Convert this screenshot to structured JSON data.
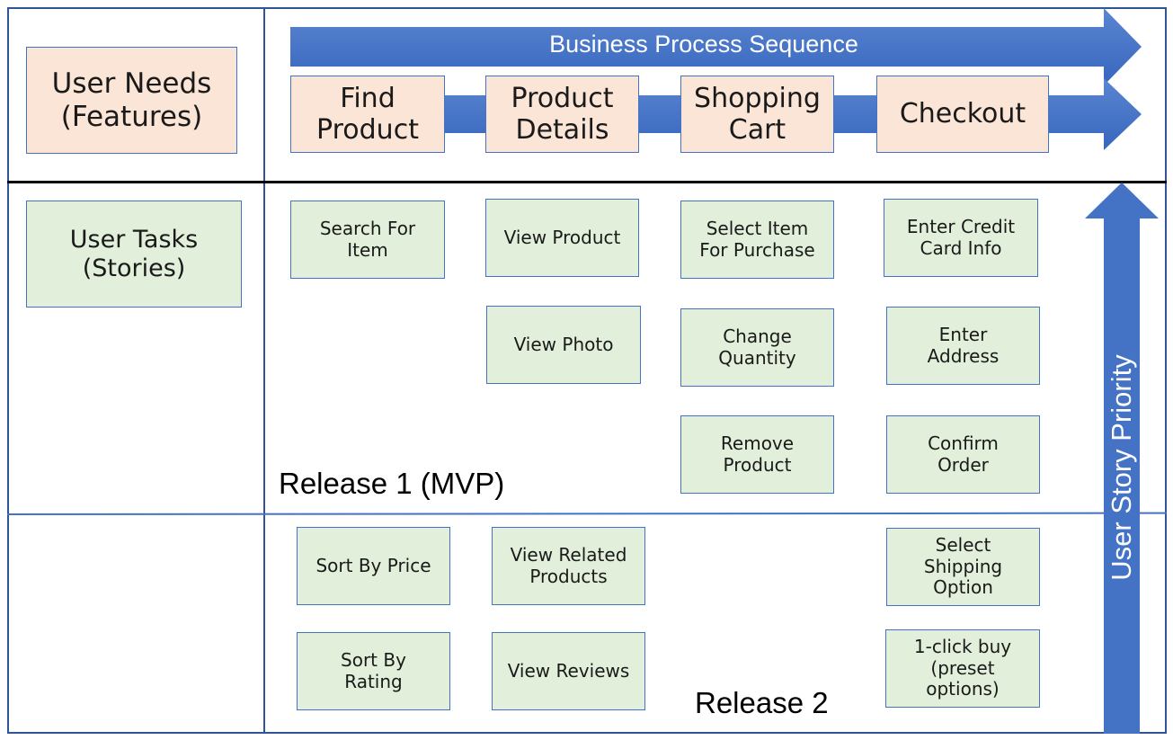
{
  "row_headers": {
    "user_needs": "User Needs\n(Features)",
    "user_tasks": "User Tasks\n(Stories)"
  },
  "business_process": {
    "label": "Business Process Sequence",
    "color": "#4472c4"
  },
  "priority_arrow": {
    "label": "User Story Priority",
    "color": "#4472c4"
  },
  "features": [
    {
      "label": "Find\nProduct"
    },
    {
      "label": "Product\nDetails"
    },
    {
      "label": "Shopping\nCart"
    },
    {
      "label": "Checkout"
    }
  ],
  "releases": [
    {
      "label": "Release 1 (MVP)",
      "stories": {
        "find_product": [
          "Search For\nItem"
        ],
        "product_details": [
          "View Product",
          "View Photo"
        ],
        "shopping_cart": [
          "Select Item\nFor Purchase",
          "Change\nQuantity",
          "Remove\nProduct"
        ],
        "checkout": [
          "Enter Credit\nCard Info",
          "Enter\nAddress",
          "Confirm\nOrder"
        ]
      }
    },
    {
      "label": "Release 2",
      "stories": {
        "find_product": [
          "Sort By Price",
          "Sort By\nRating"
        ],
        "product_details": [
          "View Related\nProducts",
          "View Reviews"
        ],
        "checkout": [
          "Select\nShipping\nOption",
          "1-click buy\n(preset\noptions)"
        ]
      }
    }
  ],
  "colors": {
    "feature_fill": "#fbe5d6",
    "story_fill": "#e2efda",
    "border": "#4472c4",
    "frame": "#2f5597"
  }
}
